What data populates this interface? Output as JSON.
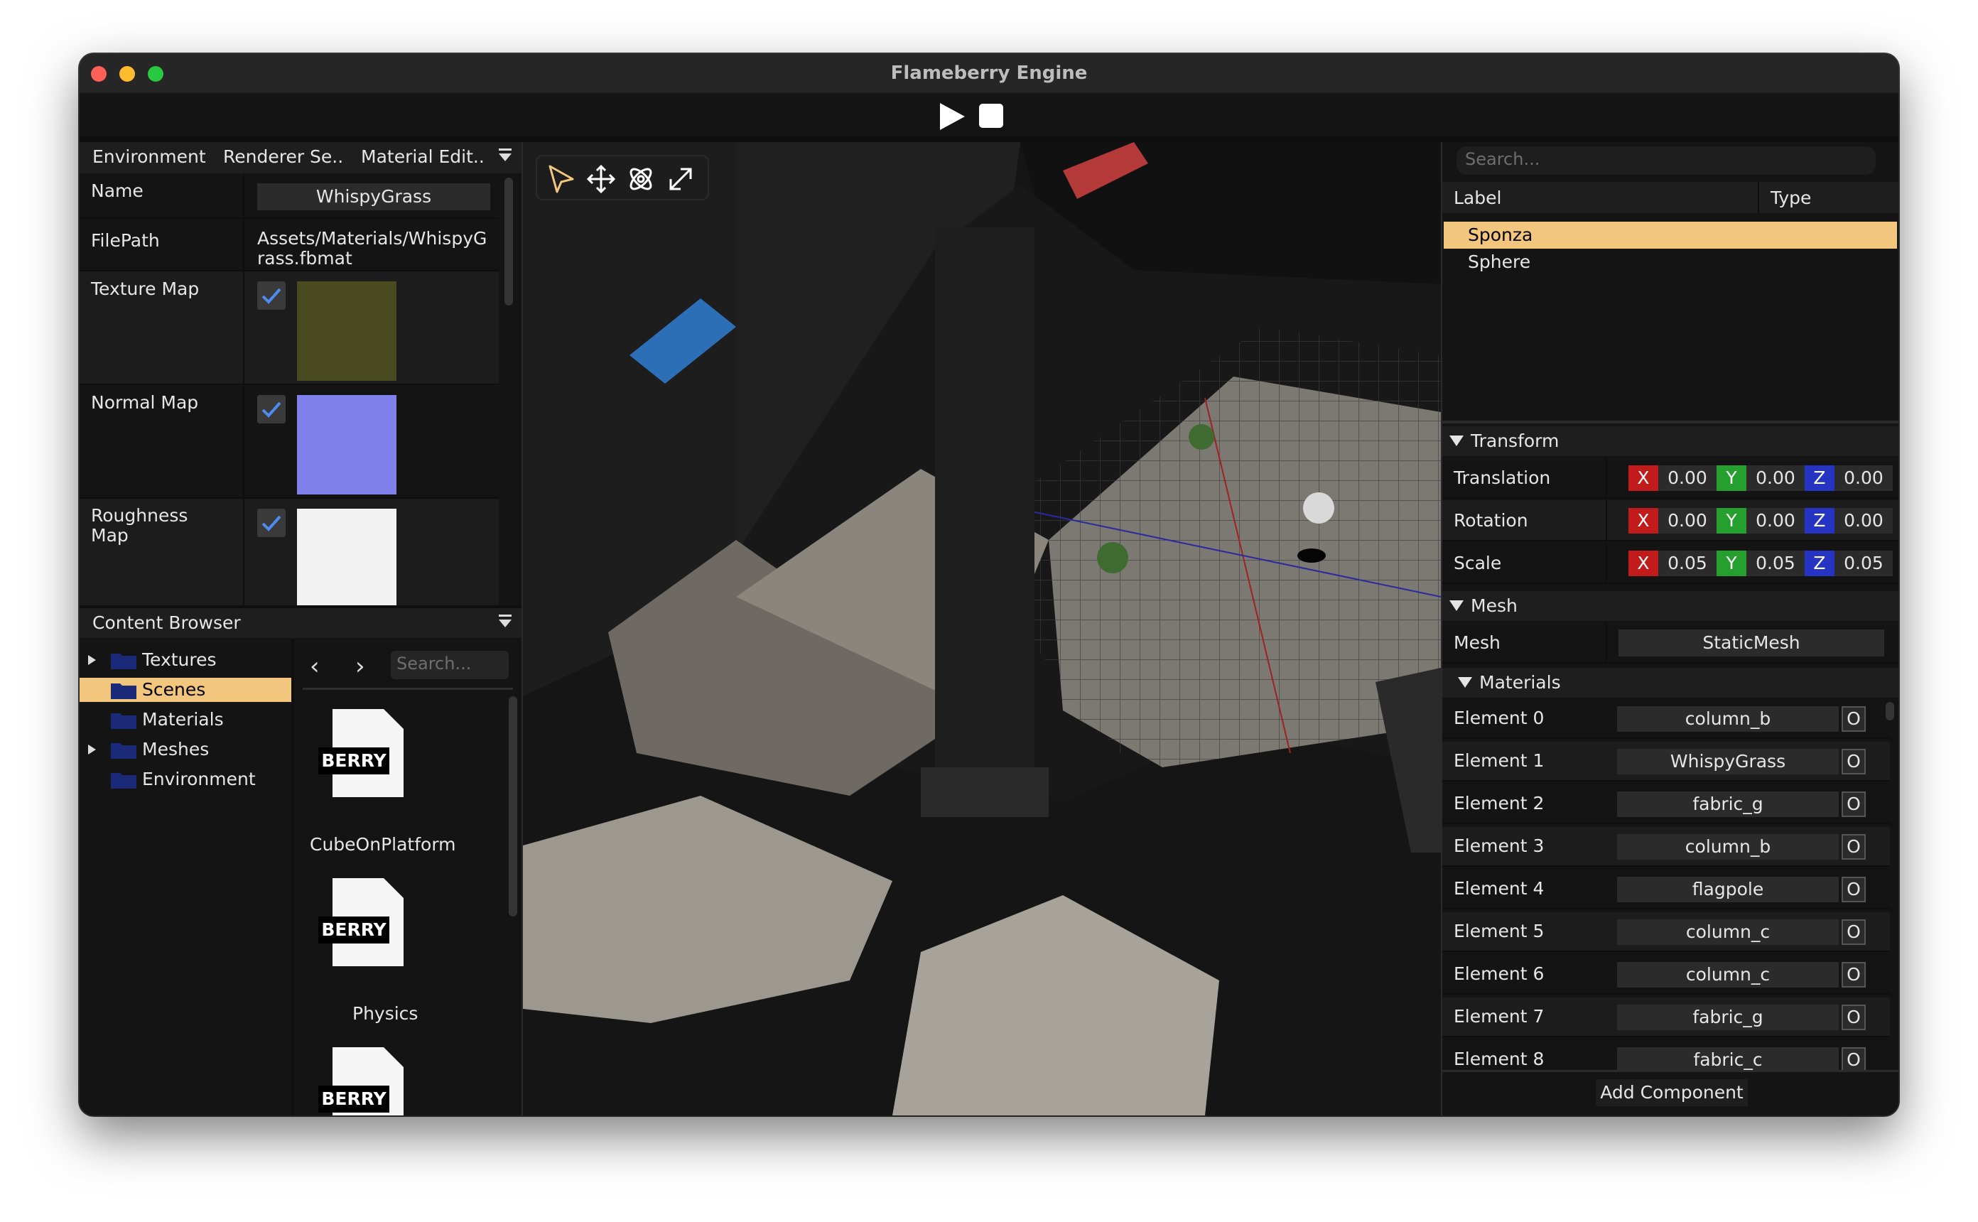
{
  "window": {
    "title": "Flameberry Engine"
  },
  "toolbar": {
    "play_icon": "play-icon",
    "stop_icon": "stop-icon"
  },
  "left_panel": {
    "tabs": [
      "Environment",
      "Renderer Se..",
      "Material Edit.."
    ],
    "name_label": "Name",
    "name_value": "WhispyGrass",
    "filepath_label": "FilePath",
    "filepath_line1": "Assets/Materials/WhispyG",
    "filepath_line2": "rass.fbmat",
    "texture_label": "Texture Map",
    "normal_label": "Normal Map",
    "roughness_line1": "Roughness",
    "roughness_line2": "Map",
    "colors": {
      "texture": "#4a4a20",
      "normal": "#8080ea",
      "roughness": "#f2f2f2"
    }
  },
  "content_browser": {
    "title": "Content Browser",
    "folders": [
      {
        "label": "Textures",
        "expandable": true
      },
      {
        "label": "Scenes",
        "expandable": false
      },
      {
        "label": "Materials",
        "expandable": false
      },
      {
        "label": "Meshes",
        "expandable": true
      },
      {
        "label": "Environment",
        "expandable": false
      }
    ],
    "search_placeholder": "Search...",
    "assets": [
      {
        "badge": "BERRY",
        "name": "CubeOnPlatform"
      },
      {
        "badge": "BERRY",
        "name": "Physics"
      },
      {
        "badge": "BERRY",
        "name": ""
      }
    ]
  },
  "viewport": {
    "gizmos": [
      "select-icon",
      "move-icon",
      "rotate-icon",
      "scale-icon"
    ]
  },
  "scene_hierarchy": {
    "search_placeholder": "Search...",
    "col_label": "Label",
    "col_type": "Type",
    "entities": [
      "Sponza",
      "Sphere"
    ]
  },
  "inspector": {
    "transform_header": "Transform",
    "translation": {
      "label": "Translation",
      "x": "0.00",
      "y": "0.00",
      "z": "0.00"
    },
    "rotation": {
      "label": "Rotation",
      "x": "0.00",
      "y": "0.00",
      "z": "0.00"
    },
    "scale": {
      "label": "Scale",
      "x": "0.05",
      "y": "0.05",
      "z": "0.05"
    },
    "axis": {
      "x": "X",
      "y": "Y",
      "z": "Z"
    },
    "mesh_header": "Mesh",
    "mesh_label": "Mesh",
    "mesh_value": "StaticMesh",
    "materials_header": "Materials",
    "materials": [
      {
        "label": "Element 0",
        "value": "column_b"
      },
      {
        "label": "Element 1",
        "value": "WhispyGrass"
      },
      {
        "label": "Element 2",
        "value": "fabric_g"
      },
      {
        "label": "Element 3",
        "value": "column_b"
      },
      {
        "label": "Element 4",
        "value": "flagpole"
      },
      {
        "label": "Element 5",
        "value": "column_c"
      },
      {
        "label": "Element 6",
        "value": "column_c"
      },
      {
        "label": "Element 7",
        "value": "fabric_g"
      },
      {
        "label": "Element 8",
        "value": "fabric_c"
      }
    ],
    "reset_glyph": "O",
    "add_component": "Add Component"
  }
}
